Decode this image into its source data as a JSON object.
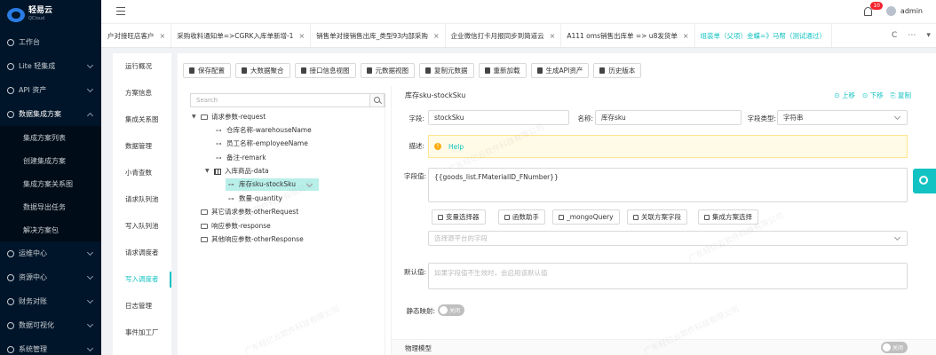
{
  "brand": {
    "name": "轻易云",
    "sub": "QCloud"
  },
  "sidebar": {
    "items": [
      {
        "label": "工作台"
      },
      {
        "label": "Lite 轻集成"
      },
      {
        "label": "API 资产"
      },
      {
        "label": "数据集成方案",
        "open": true
      }
    ],
    "subitems": [
      {
        "label": "集成方案列表"
      },
      {
        "label": "创建集成方案"
      },
      {
        "label": "集成方案关系图"
      },
      {
        "label": "数据导出任务"
      },
      {
        "label": "解决方案包"
      }
    ],
    "items2": [
      {
        "label": "运维中心"
      },
      {
        "label": "资源中心"
      },
      {
        "label": "财务对账"
      },
      {
        "label": "数据可视化"
      },
      {
        "label": "系统管理"
      }
    ]
  },
  "header": {
    "badge": "10",
    "user": "admin"
  },
  "tabs": [
    {
      "label": "户对接旺店客户",
      "active": false
    },
    {
      "label": "采购收料通知单=>CGRK入库单新增-1",
      "active": false
    },
    {
      "label": "销售单对接销售出库_类型93内部采购",
      "active": false
    },
    {
      "label": "企业微信打卡月报同步到简道云",
      "active": false
    },
    {
      "label": "A111 oms销售出库单 => u8发货单",
      "active": false
    },
    {
      "label": "组装单（父项）金蝶=》马帮（测试通过）",
      "active": true
    }
  ],
  "tab_tools": {
    "refresh": "C",
    "more": "⋯"
  },
  "subnav": [
    {
      "label": "运行概况"
    },
    {
      "label": "方案信息"
    },
    {
      "label": "集成关系图"
    },
    {
      "label": "数据管理"
    },
    {
      "label": "小青查数"
    },
    {
      "label": "请求队列池"
    },
    {
      "label": "写入队列池"
    },
    {
      "label": "请求调度者"
    },
    {
      "label": "写入调度者",
      "active": true
    },
    {
      "label": "日志管理"
    },
    {
      "label": "事件加工厂"
    }
  ],
  "toolbar": [
    {
      "label": "保存配置"
    },
    {
      "label": "大数据聚合"
    },
    {
      "label": "接口信息视图"
    },
    {
      "label": "元数据视图"
    },
    {
      "label": "复制元数据"
    },
    {
      "label": "重新加载"
    },
    {
      "label": "生成API资产"
    },
    {
      "label": "历史版本"
    }
  ],
  "tree": {
    "search_placeholder": "Search",
    "nodes": [
      {
        "label": "请求参数-request"
      },
      {
        "label": "仓库名称-warehouseName"
      },
      {
        "label": "员工名称-employeeName"
      },
      {
        "label": "备注-remark"
      },
      {
        "label": "入库商品-data"
      },
      {
        "label": "库存sku-stockSku"
      },
      {
        "label": "数量-quantity"
      },
      {
        "label": "其它请求参数-otherRequest"
      },
      {
        "label": "响应参数-response"
      },
      {
        "label": "其他响应参数-otherResponse"
      }
    ]
  },
  "panel": {
    "title": "库存sku-stockSku",
    "actions": [
      "上移",
      "下移",
      "复制"
    ],
    "field_label": "字段:",
    "field_value": "stockSku",
    "name_label": "名称:",
    "name_value": "库存sku",
    "type_label": "字段类型:",
    "type_value": "字符串",
    "desc_label": "描述:",
    "desc_help": "Help",
    "value_label": "字段值:",
    "value_text": "{{goods_list.FMaterialID_FNumber}}",
    "value_buttons": [
      "变量选择器",
      "函数助手",
      "_mongoQuery",
      "关联方案字段",
      "集成方案选择"
    ],
    "source_placeholder": "选择源平台的字段",
    "default_label": "默认值:",
    "default_placeholder": "如果字段值不生效时，会启用该默认值",
    "static_label": "静态映射:",
    "toggle_off": "关闭",
    "physical_label": "物理模型"
  },
  "watermark": "广东轻亿云软件科技有限公司"
}
